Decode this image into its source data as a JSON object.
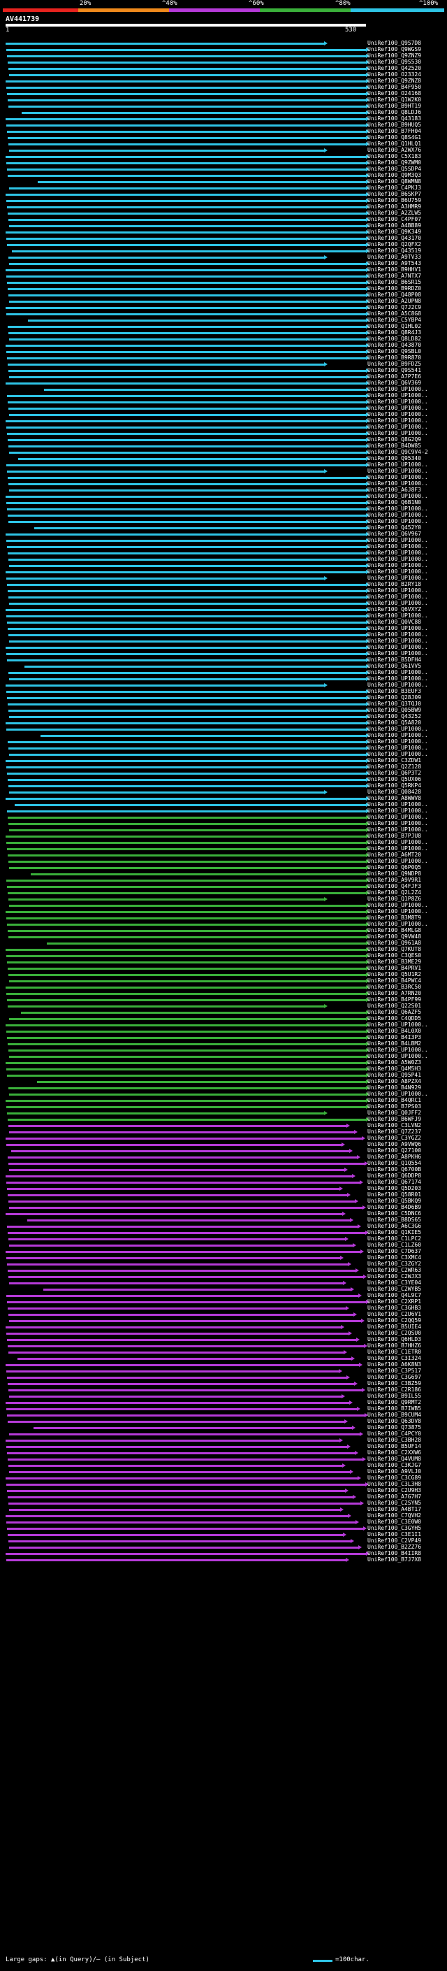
{
  "legend": {
    "labels": [
      "20%",
      "^40%",
      "^60%",
      "^80%",
      "^100%"
    ],
    "colors": {
      "red": "#e8231e",
      "orange": "#f08a1c",
      "purple": "#b63ad8",
      "green": "#3ab03a",
      "cyan": "#2ec4e6"
    }
  },
  "query": {
    "title": "AV441739",
    "start": "1",
    "end": "530"
  },
  "hits_cyan_names": [
    "UniRef100_Q9S7D8",
    "UniRef100_Q9WGS9",
    "UniRef100_Q9ZNZ9",
    "UniRef100_Q9S530",
    "UniRef100_Q42520",
    "UniRef100_O23324",
    "UniRef100_Q9ZNZ8",
    "UniRef100_B4F950",
    "UniRef100_O24168",
    "UniRef100_Q1W2K0",
    "UniRef100_B9HT19",
    "UniRef100_Q8LDJ6",
    "UniRef100_Q43183",
    "UniRef100_B9HUQ5",
    "UniRef100_B7FH04",
    "UniRef100_Q8S4G1",
    "UniRef100_Q1HLQ1",
    "UniRef100_A2WX76",
    "UniRef100_C5X183",
    "UniRef100_Q9ZWM0",
    "UniRef100_Q5SDP4",
    "UniRef100_Q9M3Q3",
    "UniRef100_Q8WMN8",
    "UniRef100_C4PKJ3",
    "UniRef100_B6SKP7",
    "UniRef100_B6U759",
    "UniRef100_A3HMR9",
    "UniRef100_A2ZLW5",
    "UniRef100_C4PF07",
    "UniRef100_A4BB89",
    "UniRef100_Q9K349",
    "UniRef100_Q43170",
    "UniRef100_Q2QFX2",
    "UniRef100_Q43519",
    "UniRef100_A9TV33",
    "UniRef100_A9T543",
    "UniRef100_B9HHV1",
    "UniRef100_A7NTX7",
    "UniRef100_B6SR15",
    "UniRef100_B9RDZ0",
    "UniRef100_Q48P08",
    "UniRef100_A2UPN8",
    "UniRef100_Q7J2C9",
    "UniRef100_A5C8G8",
    "UniRef100_C5YBP4",
    "UniRef100_Q1HL02",
    "UniRef100_Q8R4J3",
    "UniRef100_Q8LD82",
    "UniRef100_Q43870",
    "UniRef100_Q9SBL0",
    "UniRef100_B9R870",
    "UniRef100_B9FDZ5",
    "UniRef100_Q9S541",
    "UniRef100_A7P7E6",
    "UniRef100_Q6V369",
    "UniRef100_UP1000..",
    "UniRef100_UP1000..",
    "UniRef100_UP1000..",
    "UniRef100_UP1000..",
    "UniRef100_UP1000..",
    "UniRef100_UP1000..",
    "UniRef100_UP1000..",
    "UniRef100_UP1000..",
    "UniRef100_Q8G2Q9",
    "UniRef100_B4DW85",
    "UniRef100_Q9C9V4-2",
    "UniRef100_Q95340",
    "UniRef100_UP1000..",
    "UniRef100_UP1000..",
    "UniRef100_UP1000..",
    "UniRef100_UP1000..",
    "UniRef100_A6J8F3",
    "UniRef100_UP1000..",
    "UniRef100_Q6B1N0",
    "UniRef100_UP1000..",
    "UniRef100_UP1000..",
    "UniRef100_UP1000..",
    "UniRef100_Q452Y0",
    "UniRef100_Q6V967",
    "UniRef100_UP1000..",
    "UniRef100_UP1000..",
    "UniRef100_UP1000..",
    "UniRef100_UP1000..",
    "UniRef100_UP1000..",
    "UniRef100_UP1000..",
    "UniRef100_UP1000..",
    "UniRef100_B2RY18",
    "UniRef100_UP1000..",
    "UniRef100_UP1000..",
    "UniRef100_UP1000..",
    "UniRef100_Q6VXYZ",
    "UniRef100_UP1000..",
    "UniRef100_Q0VC88",
    "UniRef100_UP1000..",
    "UniRef100_UP1000..",
    "UniRef100_UP1000..",
    "UniRef100_UP1000..",
    "UniRef100_UP1000..",
    "UniRef100_B5DFH4",
    "UniRef100_Q61VV5",
    "UniRef100_UP1000..",
    "UniRef100_UP1000..",
    "UniRef100_UP1000..",
    "UniRef100_B3EUF3",
    "UniRef100_Q28J09",
    "UniRef100_Q3TQJ0",
    "UniRef100_Q05BW9",
    "UniRef100_Q43252",
    "UniRef100_Q5A820",
    "UniRef100_UP1000..",
    "UniRef100_UP1000..",
    "UniRef100_UP1000..",
    "UniRef100_UP1000..",
    "UniRef100_UP1000..",
    "UniRef100_C3ZDW1",
    "UniRef100_Q2Z128",
    "UniRef100_Q6P3T2",
    "UniRef100_Q5UX06",
    "UniRef100_Q5RKP4",
    "UniRef100_Q08428",
    "UniRef100_A8WWV8",
    "UniRef100_UP1000..",
    "UniRef100_UP1000.."
  ],
  "hits_green_names": [
    "UniRef100_UP1000..",
    "UniRef100_UP1000..",
    "UniRef100_UP1000..",
    "UniRef100_B7PJU8",
    "UniRef100_UP1000..",
    "UniRef100_UP1000..",
    "UniRef100_A6MT20",
    "UniRef100_UP1000..",
    "UniRef100_Q6P0Q5",
    "UniRef100_Q9NDP8",
    "UniRef100_A9V9R1",
    "UniRef100_Q4FJF3",
    "UniRef100_Q2L2Z4",
    "UniRef100_Q1P8Z6",
    "UniRef100_UP1000..",
    "UniRef100_UP1000..",
    "UniRef100_B3M8T9",
    "UniRef100_UP1000..",
    "UniRef100_B4MLG8",
    "UniRef100_Q9VW48",
    "UniRef100_Q961A8",
    "UniRef100_Q7KUT8",
    "UniRef100_C3QES0",
    "UniRef100_B3ME29",
    "UniRef100_B4PRV1",
    "UniRef100_Q5U1R2",
    "UniRef100_B4PWC4",
    "UniRef100_B3RC50",
    "UniRef100_A7RN20",
    "UniRef100_B4PF99",
    "UniRef100_Q22S01",
    "UniRef100_Q6AZF5",
    "UniRef100_C4QDD5",
    "UniRef100_UP1000..",
    "UniRef100_B4L0X0",
    "UniRef100_B4I3P3",
    "UniRef100_B4LBM2",
    "UniRef100_UP1000..",
    "UniRef100_UP1000..",
    "UniRef100_A5W0Z3",
    "UniRef100_Q4M5H3",
    "UniRef100_Q95P41",
    "UniRef100_A8PZX4",
    "UniRef100_B4N929",
    "UniRef100_UP1000..",
    "UniRef100_B4QRC1",
    "UniRef100_B7PS03",
    "UniRef100_Q0JFF2",
    "UniRef100_B6WFJ9"
  ],
  "hits_purple_names": [
    "UniRef100_C3LVN2",
    "UniRef100_Q7Z237",
    "UniRef100_C3YGZ2",
    "UniRef100_A9VWQ6",
    "UniRef100_Q27100",
    "UniRef100_A8PKH6",
    "UniRef100_Q1Q554",
    "UniRef100_Q6700B",
    "UniRef100_Q6DDP8",
    "UniRef100_Q67174",
    "UniRef100_Q5D203",
    "UniRef100_Q58R01",
    "UniRef100_Q5BKQ9",
    "UniRef100_B4D6B9",
    "UniRef100_C5DNC6",
    "UniRef100_B8DS65",
    "UniRef100_A6C3G6",
    "UniRef100_Q1KIE5",
    "UniRef100_C1LPC2",
    "UniRef100_C1LZ60",
    "UniRef100_C7D637",
    "UniRef100_C3XMC4",
    "UniRef100_C3ZGY2",
    "UniRef100_C2WR63",
    "UniRef100_C2WJX3",
    "UniRef100_C3YE04",
    "UniRef100_C2WYB5",
    "UniRef100_Q4L9C7",
    "UniRef100_C2XRP1",
    "UniRef100_C3GHB3",
    "UniRef100_C2U6V1",
    "UniRef100_C2QQ59",
    "UniRef100_B5UIE4",
    "UniRef100_C2QSU0",
    "UniRef100_Q6HLD3",
    "UniRef100_B7HHZ6",
    "UniRef100_C1ETR0",
    "UniRef100_C3I324",
    "UniRef100_A6K8N3",
    "UniRef100_C3P517",
    "UniRef100_C3G697",
    "UniRef100_C3BZ59",
    "UniRef100_C2R186",
    "UniRef100_B9IL55",
    "UniRef100_Q9RMT2",
    "UniRef100_B7IWB5",
    "UniRef100_B9CUM4",
    "UniRef100_Q63DV8",
    "UniRef100_Q73875",
    "UniRef100_C4PCY0",
    "UniRef100_C3BH28",
    "UniRef100_B5UF14",
    "UniRef100_C2XXW6",
    "UniRef100_Q4VUM8",
    "UniRef100_C3KJG7",
    "UniRef100_A9VLJ0",
    "UniRef100_C3CG89",
    "UniRef100_C3L3H8",
    "UniRef100_C2U9H3",
    "UniRef100_A7G7H7",
    "UniRef100_C2SYN5",
    "UniRef100_A4BT17",
    "UniRef100_C7QVH2",
    "UniRef100_C3E0W0",
    "UniRef100_C3GYH5",
    "UniRef100_C3E1I1",
    "UniRef100_C2VP49",
    "UniRef100_B2ZZ76",
    "UniRef100_B4IIR8",
    "UniRef100_B7J7X8"
  ],
  "footer": {
    "gaps_text": "Large gaps: ▲(in Query)/— (in Subject)",
    "scale_text": "=100char."
  }
}
